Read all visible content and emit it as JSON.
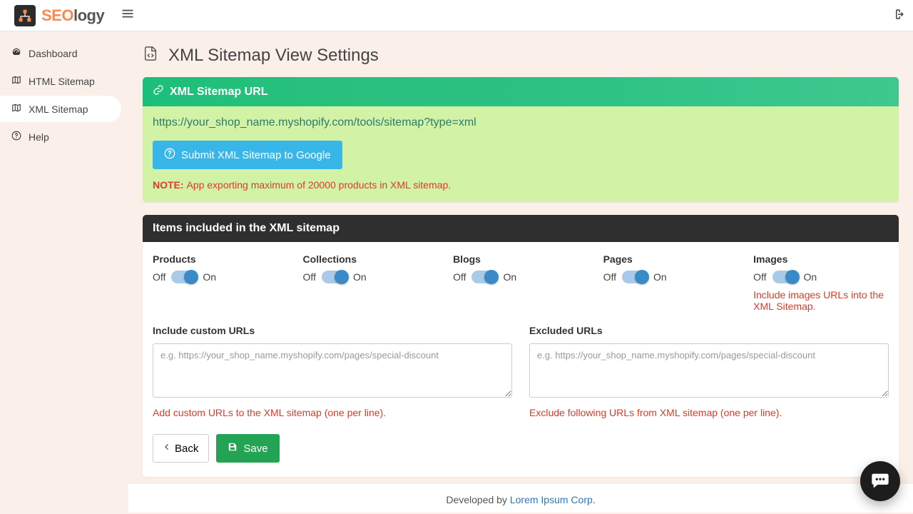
{
  "header": {
    "brand_accent": "SEO",
    "brand_rest": "logy"
  },
  "sidebar": {
    "items": [
      {
        "label": "Dashboard"
      },
      {
        "label": "HTML Sitemap"
      },
      {
        "label": "XML Sitemap"
      },
      {
        "label": "Help"
      }
    ]
  },
  "page": {
    "title": "XML Sitemap View Settings"
  },
  "url_card": {
    "header": "XML Sitemap URL",
    "url": "https://your_shop_name.myshopify.com/tools/sitemap?type=xml",
    "submit_label": " Submit XML Sitemap to Google",
    "note_label": "NOTE: ",
    "note_text": "App exporting maximum of 20000 products in XML sitemap."
  },
  "items_card": {
    "header": "Items included in the XML sitemap",
    "off": "Off",
    "on": "On",
    "toggles": [
      {
        "name": "Products"
      },
      {
        "name": "Collections"
      },
      {
        "name": "Blogs"
      },
      {
        "name": "Pages"
      },
      {
        "name": "Images",
        "help": "Include images URLs into the XML Sitemap."
      }
    ],
    "include": {
      "label": "Include custom URLs",
      "placeholder": "e.g. https://your_shop_name.myshopify.com/pages/special-discount",
      "help": "Add custom URLs to the XML sitemap (one per line)."
    },
    "exclude": {
      "label": "Excluded URLs",
      "placeholder": "e.g. https://your_shop_name.myshopify.com/pages/special-discount",
      "help": "Exclude following URLs from XML sitemap (one per line)."
    },
    "back_label": " Back",
    "save_label": " Save"
  },
  "footer": {
    "pre": "Developed by ",
    "link": "Lorem Ipsum Corp",
    "post": "."
  }
}
